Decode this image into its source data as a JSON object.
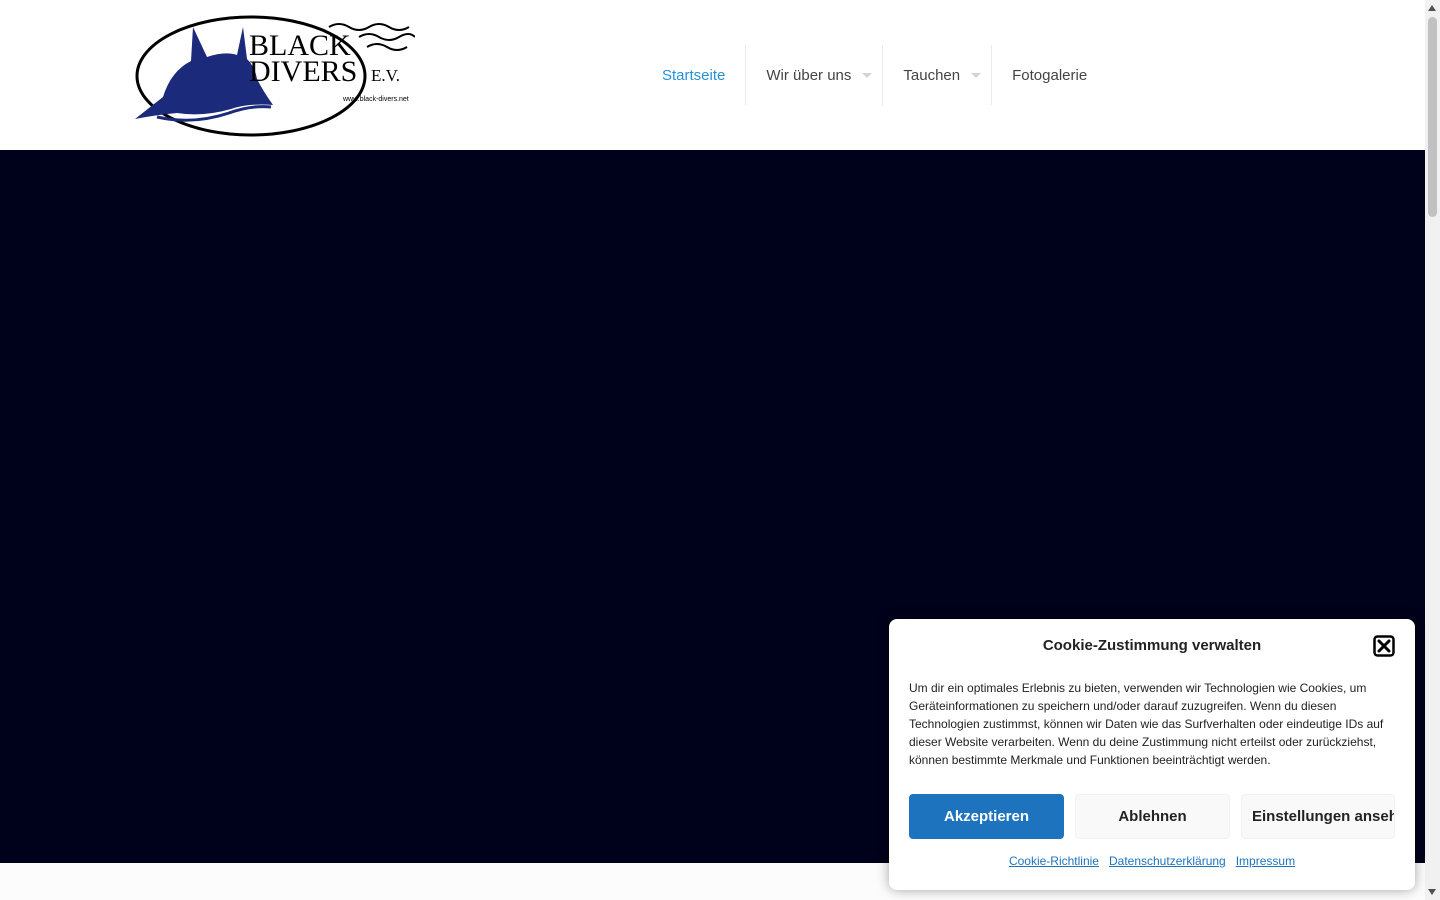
{
  "header": {
    "logo": {
      "line1": "BLACK",
      "line2": "DIVERS",
      "suffix": "E.V.",
      "url": "www.black-divers.net"
    },
    "nav": [
      {
        "label": "Startseite",
        "active": true,
        "has_submenu": false
      },
      {
        "label": "Wir über uns",
        "active": false,
        "has_submenu": true
      },
      {
        "label": "Tauchen",
        "active": false,
        "has_submenu": true
      },
      {
        "label": "Fotogalerie",
        "active": false,
        "has_submenu": false
      }
    ]
  },
  "cookie_banner": {
    "title": "Cookie-Zustimmung verwalten",
    "body": "Um dir ein optimales Erlebnis zu bieten, verwenden wir Technologien wie Cookies, um Geräteinformationen zu speichern und/oder darauf zuzugreifen. Wenn du diesen Technologien zustimmst, können wir Daten wie das Surfverhalten oder eindeutige IDs auf dieser Website verarbeiten. Wenn du deine Zustimmung nicht erteilst oder zurückziehst, können bestimmte Merkmale und Funktionen beeinträchtigt werden.",
    "accept_label": "Akzeptieren",
    "deny_label": "Ablehnen",
    "settings_label": "Einstellungen ansehen",
    "links": [
      "Cookie-Richtlinie",
      "Datenschutzerklärung",
      "Impressum"
    ]
  },
  "colors": {
    "nav_active": "#2991d6",
    "hero_background": "#00011a",
    "accept_button": "#1e73be",
    "logo_blue": "#1b2a7a"
  }
}
